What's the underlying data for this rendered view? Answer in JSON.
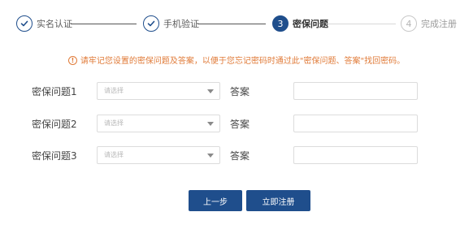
{
  "steps": [
    {
      "label": "实名认证",
      "state": "done",
      "number": ""
    },
    {
      "label": "手机验证",
      "state": "done",
      "number": ""
    },
    {
      "label": "密保问题",
      "state": "active",
      "number": "3"
    },
    {
      "label": "完成注册",
      "state": "todo",
      "number": "4"
    }
  ],
  "notice": {
    "icon": "warning-circle-icon",
    "text": "请牢记您设置的密保问题及答案，以便于您忘记密码时通过此\"密保问题、答案\"找回密码。"
  },
  "questions": [
    {
      "label": "密保问题1",
      "select_placeholder": "请选择",
      "answer_label": "答案",
      "answer_value": ""
    },
    {
      "label": "密保问题2",
      "select_placeholder": "请选择",
      "answer_label": "答案",
      "answer_value": ""
    },
    {
      "label": "密保问题3",
      "select_placeholder": "请选择",
      "answer_label": "答案",
      "answer_value": ""
    }
  ],
  "buttons": {
    "prev": "上一步",
    "submit": "立即注册"
  },
  "colors": {
    "primary": "#1f4e8c",
    "notice": "#e07b39",
    "inactive": "#c8c8c8"
  }
}
